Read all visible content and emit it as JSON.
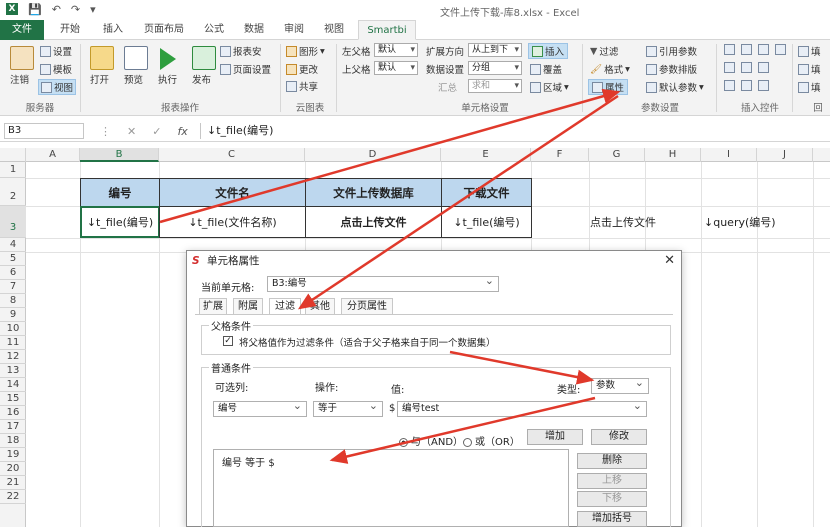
{
  "window": {
    "title": "文件上传下载-库8.xlsx - Excel"
  },
  "tabs": [
    "文件",
    "开始",
    "插入",
    "页面布局",
    "公式",
    "数据",
    "审阅",
    "视图",
    "Smartbi"
  ],
  "ribbon": {
    "server": {
      "label": "服务器",
      "logout": "注销",
      "settings": "设置",
      "template": "模板",
      "view": "视图"
    },
    "report_ops": {
      "label": "报表操作",
      "open": "打开",
      "preview": "预览",
      "run": "执行",
      "publish": "发布",
      "report_settings": "报表安",
      "page_setup": "页面设置"
    },
    "cloud_chart": {
      "label": "云图表",
      "chart": "图形",
      "change": "更改",
      "share": "共享"
    },
    "cell_settings": {
      "label": "单元格设置",
      "left_parent": "左父格",
      "left_parent_value": "默认",
      "top_parent": "上父格",
      "top_parent_value": "默认",
      "expand_dir": "扩展方向",
      "expand_dir_value": "从上到下",
      "data_settings": "数据设置",
      "data_settings_value": "分组",
      "summary": "汇总",
      "summary_value": "求和",
      "insert": "插入",
      "overwrite": "覆盖",
      "area": "区域"
    },
    "param_settings": {
      "label": "参数设置",
      "filter": "过滤",
      "format": "格式",
      "properties": "属性",
      "ref_param": "引用参数",
      "param_layout": "参数排版",
      "default_param": "默认参数"
    },
    "insert_controls": {
      "label": "插入控件"
    },
    "extra": "填",
    "extra2": "回"
  },
  "formula_bar": {
    "name_box": "B3",
    "fx": "fx",
    "formula": "↓t_file(编号)"
  },
  "grid": {
    "columns": [
      "A",
      "B",
      "C",
      "D",
      "E",
      "F",
      "G",
      "H",
      "I",
      "J"
    ],
    "rows": [
      "1",
      "2",
      "3",
      "4",
      "5",
      "6",
      "7",
      "8",
      "9",
      "10",
      "11",
      "12",
      "13",
      "14",
      "15",
      "16",
      "17",
      "18",
      "19",
      "20",
      "21",
      "22"
    ],
    "selected_col": "B",
    "selected_row": "3",
    "headers": [
      "编号",
      "文件名",
      "文件上传数据库",
      "下载文件"
    ],
    "row3": [
      "↓t_file(编号)",
      "↓t_file(文件名称)",
      "点击上传文件",
      "↓t_file(编号)"
    ],
    "g3": "点击上传文件",
    "i3": "↓query(编号)"
  },
  "dialog": {
    "title": "单元格属性",
    "current_cell_label": "当前单元格:",
    "current_cell_value": "B3:编号",
    "tabs": [
      "扩展",
      "附属",
      "过滤",
      "其他",
      "分页属性"
    ],
    "active_tab": "过滤",
    "parent_condition": {
      "legend": "父格条件",
      "checkbox_label": "将父格值作为过滤条件（适合于父子格来自于同一个数据集）",
      "checked": true
    },
    "normal_condition": {
      "legend": "普通条件",
      "col_label": "可选列:",
      "op_label": "操作:",
      "val_label": "值:",
      "type_label": "类型:",
      "type_value": "参数",
      "col_value": "编号",
      "op_value": "等于",
      "val_prefix": "$",
      "val_value": "编号test",
      "and_label": "与（AND）",
      "or_label": "或（OR）",
      "add_btn": "增加",
      "modify_btn": "修改",
      "condition_item": "编号 等于 $",
      "delete_btn": "删除",
      "up_btn": "上移",
      "down_btn": "下移",
      "add_bracket_btn": "增加括号"
    }
  },
  "colors": {
    "excel_green": "#217346",
    "header_fill": "#bdd7ee",
    "arrow_red": "#e0392b"
  }
}
